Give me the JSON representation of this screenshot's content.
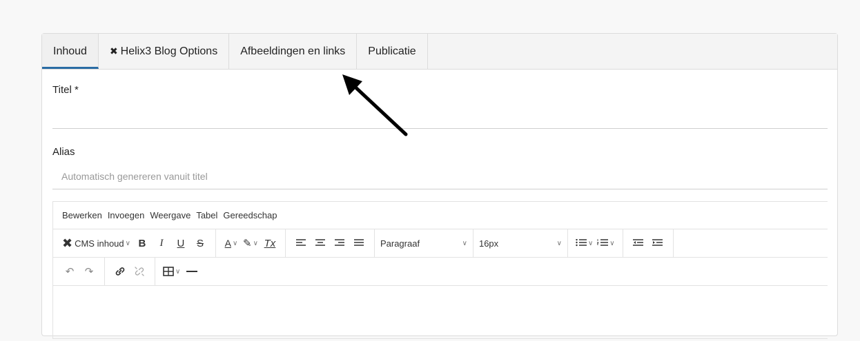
{
  "tabs": [
    {
      "label": "Inhoud",
      "icon": "",
      "active": true
    },
    {
      "label": "Helix3 Blog Options",
      "icon": "joomla-icon",
      "active": false
    },
    {
      "label": "Afbeeldingen en links",
      "icon": "",
      "active": false
    },
    {
      "label": "Publicatie",
      "icon": "",
      "active": false
    }
  ],
  "form": {
    "title_label": "Titel *",
    "title_value": "",
    "alias_label": "Alias",
    "alias_placeholder": "Automatisch genereren vanuit titel"
  },
  "editor": {
    "menus": [
      "Bewerken",
      "Invoegen",
      "Weergave",
      "Tabel",
      "Gereedschap"
    ],
    "cms_label": "CMS inhoud",
    "block_format": "Paragraaf",
    "font_size": "16px",
    "bold": "B",
    "italic": "I",
    "underline": "U",
    "strike": "S",
    "text_color": "A",
    "clear_format": "Tx"
  },
  "colors": {
    "accent": "#2a6ca4",
    "arrow": "#000000"
  }
}
